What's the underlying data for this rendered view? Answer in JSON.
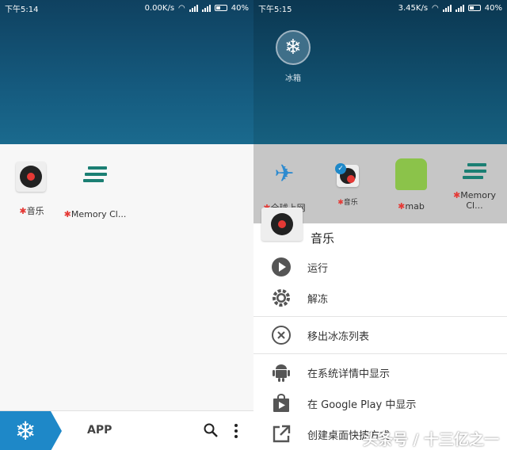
{
  "left": {
    "status": {
      "time": "下午5:14",
      "speed": "0.00K/s",
      "battery": "40%"
    },
    "apps": [
      {
        "icon": "music-record-icon",
        "label": "音乐"
      },
      {
        "icon": "memory-cleaner-icon",
        "label": "Memory Cl..."
      }
    ],
    "bottom_bar": {
      "title": "APP",
      "fab_icon": "snowflake-icon"
    }
  },
  "right": {
    "status": {
      "time": "下午5:15",
      "speed": "3.45K/s",
      "battery": "40%"
    },
    "frozen": {
      "label": "冰箱"
    },
    "dim_apps": [
      {
        "label": "全球上网"
      },
      {
        "label": "音乐"
      },
      {
        "label": "mab"
      },
      {
        "label": "Memory Cl..."
      }
    ],
    "sheet": {
      "title": "音乐",
      "items": [
        {
          "icon": "play-icon",
          "label": "运行"
        },
        {
          "icon": "gear-icon",
          "label": "解冻"
        },
        {
          "icon": "remove-circle-icon",
          "label": "移出冰冻列表"
        },
        {
          "icon": "android-icon",
          "label": "在系统详情中显示"
        },
        {
          "icon": "google-play-icon",
          "label": "在 Google Play 中显示"
        },
        {
          "icon": "open-external-icon",
          "label": "创建桌面快捷方式"
        }
      ]
    },
    "watermark": "头条号 / 十三亿之一"
  },
  "colors": {
    "accent": "#1e88c8",
    "header": "#155a7e",
    "star": "#e53935"
  }
}
